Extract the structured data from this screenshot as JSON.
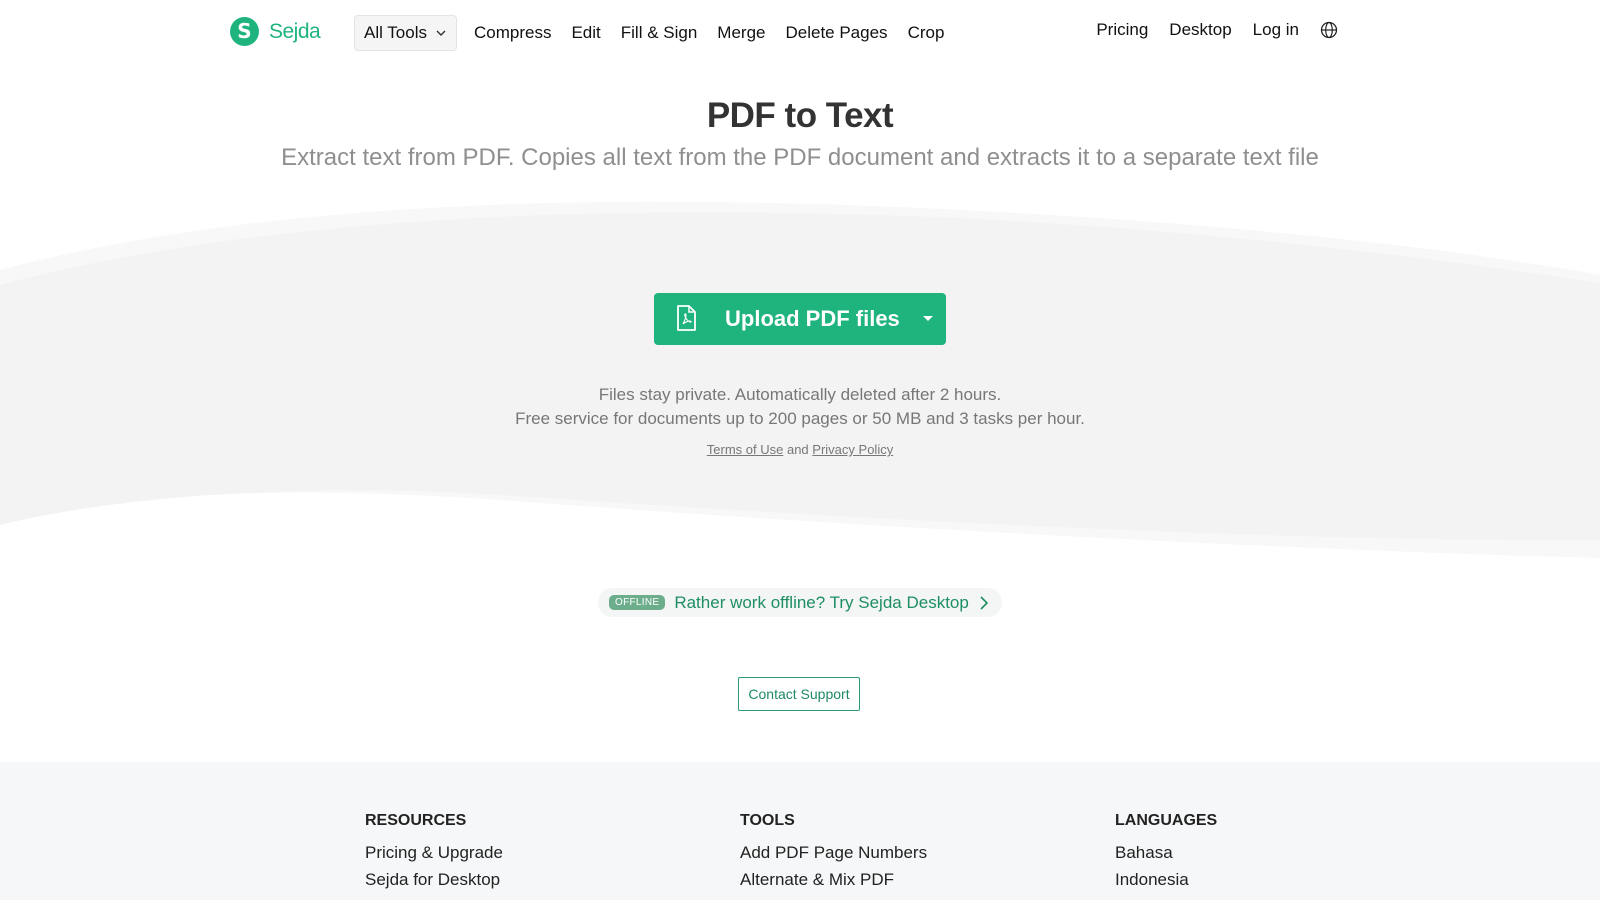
{
  "brand": {
    "name": "Sejda",
    "logo_letter": "S",
    "color": "#1fb37e"
  },
  "nav": {
    "all_tools": "All Tools",
    "links": [
      "Compress",
      "Edit",
      "Fill & Sign",
      "Merge",
      "Delete Pages",
      "Crop"
    ],
    "right": [
      "Pricing",
      "Desktop",
      "Log in"
    ],
    "icons": [
      "chevron-down-icon",
      "globe-icon"
    ]
  },
  "hero": {
    "title": "PDF to Text",
    "subtitle": "Extract text from PDF. Copies all text from the PDF document and extracts it to a separate text file",
    "upload_label": "Upload PDF files",
    "info_line1": "Files stay private. Automatically deleted after 2 hours.",
    "info_line2": "Free service for documents up to 200 pages or 50 MB and 3 tasks per hour.",
    "terms": "Terms of Use",
    "and": "and",
    "privacy": "Privacy Policy"
  },
  "offline": {
    "badge": "OFFLINE",
    "text": "Rather work offline? Try Sejda Desktop"
  },
  "contact": "Contact Support",
  "footer": {
    "resources": {
      "heading": "RESOURCES",
      "items": [
        "Pricing & Upgrade",
        "Sejda for Desktop"
      ]
    },
    "tools": {
      "heading": "TOOLS",
      "items": [
        "Add PDF Page Numbers",
        "Alternate & Mix PDF"
      ]
    },
    "languages": {
      "heading": "LANGUAGES",
      "items": [
        "Bahasa",
        "Indonesia"
      ]
    }
  },
  "colors": {
    "accent": "#1fb37e",
    "wave": "#f3f3f3",
    "footer_bg": "#f6f7f8"
  }
}
